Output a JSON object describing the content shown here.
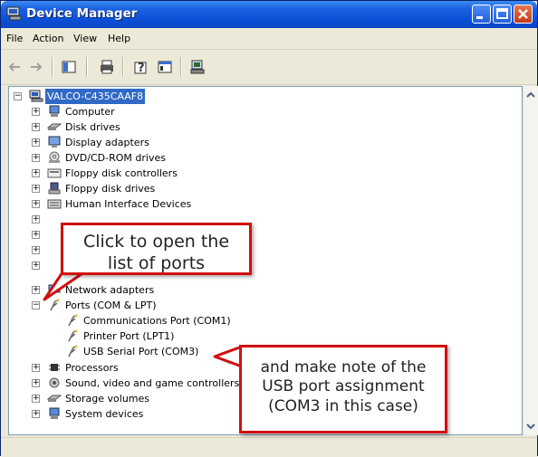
{
  "window": {
    "title": "Device Manager"
  },
  "menu": [
    "File",
    "Action",
    "View",
    "Help"
  ],
  "tree": {
    "root": "VALCO-C435CAAF8",
    "items": [
      {
        "label": "Computer",
        "icon": "computer-icon",
        "expanded": false
      },
      {
        "label": "Disk drives",
        "icon": "disk-drive-icon",
        "expanded": false
      },
      {
        "label": "Display adapters",
        "icon": "display-adapter-icon",
        "expanded": false
      },
      {
        "label": "DVD/CD-ROM drives",
        "icon": "dvd-drive-icon",
        "expanded": false
      },
      {
        "label": "Floppy disk controllers",
        "icon": "floppy-controller-icon",
        "expanded": false
      },
      {
        "label": "Floppy disk drives",
        "icon": "floppy-drive-icon",
        "expanded": false
      },
      {
        "label": "Human Interface Devices",
        "icon": "hid-icon",
        "expanded": false
      },
      {
        "label": "Network adapters",
        "icon": "network-adapter-icon",
        "expanded": false
      },
      {
        "label": "Ports (COM & LPT)",
        "icon": "port-icon",
        "expanded": true
      },
      {
        "label": "Processors",
        "icon": "processor-icon",
        "expanded": false
      },
      {
        "label": "Sound, video and game controllers",
        "icon": "sound-icon",
        "expanded": false
      },
      {
        "label": "Storage volumes",
        "icon": "storage-icon",
        "expanded": false
      },
      {
        "label": "System devices",
        "icon": "system-device-icon",
        "expanded": false
      }
    ],
    "ports_children": [
      "Communications Port (COM1)",
      "Printer Port (LPT1)",
      "USB Serial Port (COM3)"
    ]
  },
  "callouts": {
    "first": [
      "Click to open the",
      "list of ports"
    ],
    "second": [
      "and make note of the",
      "USB port assignment",
      "(COM3 in this case)"
    ]
  },
  "colors": {
    "title_bar": "#0a4fd6",
    "selection": "#316ac5",
    "callout_border": "#d01010"
  }
}
